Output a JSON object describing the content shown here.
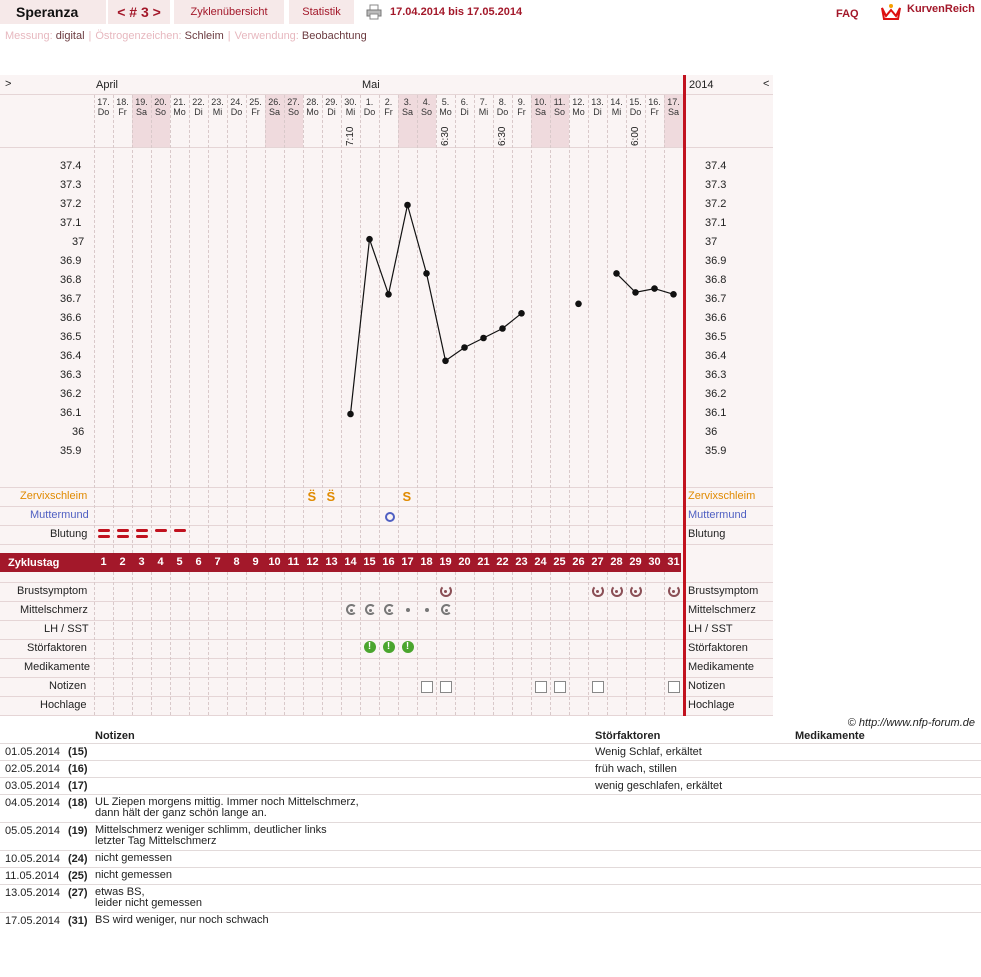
{
  "header": {
    "title": "Speranza",
    "cycle": "< # 3 >",
    "overview": "Zyklenübersicht",
    "statistics": "Statistik",
    "date_range": "17.04.2014 bis 17.05.2014",
    "faq": "FAQ",
    "logo": "KurvenReich"
  },
  "subheader": {
    "measure_label": "Messung:",
    "measure_value": "digital",
    "estrogen_label": "Östrogenzeichen:",
    "estrogen_value": "Schleim",
    "usage_label": "Verwendung:",
    "usage_value": "Beobachtung"
  },
  "nav": {
    "left": ">",
    "right": "<",
    "year": "2014"
  },
  "months": {
    "april": "April",
    "mai": "Mai"
  },
  "days": [
    {
      "d": "17.",
      "w": "Do",
      "we": false
    },
    {
      "d": "18.",
      "w": "Fr",
      "we": false
    },
    {
      "d": "19.",
      "w": "Sa",
      "we": true
    },
    {
      "d": "20.",
      "w": "So",
      "we": true
    },
    {
      "d": "21.",
      "w": "Mo",
      "we": false
    },
    {
      "d": "22.",
      "w": "Di",
      "we": false
    },
    {
      "d": "23.",
      "w": "Mi",
      "we": false
    },
    {
      "d": "24.",
      "w": "Do",
      "we": false
    },
    {
      "d": "25.",
      "w": "Fr",
      "we": false
    },
    {
      "d": "26.",
      "w": "Sa",
      "we": true
    },
    {
      "d": "27.",
      "w": "So",
      "we": true
    },
    {
      "d": "28.",
      "w": "Mo",
      "we": false
    },
    {
      "d": "29.",
      "w": "Di",
      "we": false
    },
    {
      "d": "30.",
      "w": "Mi",
      "we": false
    },
    {
      "d": "1.",
      "w": "Do",
      "we": false
    },
    {
      "d": "2.",
      "w": "Fr",
      "we": false
    },
    {
      "d": "3.",
      "w": "Sa",
      "we": true
    },
    {
      "d": "4.",
      "w": "So",
      "we": true
    },
    {
      "d": "5.",
      "w": "Mo",
      "we": false
    },
    {
      "d": "6.",
      "w": "Di",
      "we": false
    },
    {
      "d": "7.",
      "w": "Mi",
      "we": false
    },
    {
      "d": "8.",
      "w": "Do",
      "we": false
    },
    {
      "d": "9.",
      "w": "Fr",
      "we": false
    },
    {
      "d": "10.",
      "w": "Sa",
      "we": true
    },
    {
      "d": "11.",
      "w": "So",
      "we": true
    },
    {
      "d": "12.",
      "w": "Mo",
      "we": false
    },
    {
      "d": "13.",
      "w": "Di",
      "we": false
    },
    {
      "d": "14.",
      "w": "Mi",
      "we": false
    },
    {
      "d": "15.",
      "w": "Do",
      "we": false
    },
    {
      "d": "16.",
      "w": "Fr",
      "we": false
    },
    {
      "d": "17.",
      "w": "Sa",
      "we": true
    }
  ],
  "times": [
    {
      "day": 14,
      "t": "7:10"
    },
    {
      "day": 19,
      "t": "6:30"
    },
    {
      "day": 22,
      "t": "6:30"
    },
    {
      "day": 29,
      "t": "6:00"
    }
  ],
  "rows_labels": {
    "zervix": "Zervixschleim",
    "muttermund": "Muttermund",
    "blutung": "Blutung",
    "zyklustag": "Zyklustag",
    "brust": "Brustsymptom",
    "mittel": "Mittelschmerz",
    "lh": "LH / SST",
    "stoer": "Störfaktoren",
    "medi": "Medikamente",
    "notizen": "Notizen",
    "hoch": "Hochlage"
  },
  "chart_data": {
    "type": "line",
    "ylim": [
      35.9,
      37.4
    ],
    "yticks": [
      "37.4",
      "37.3",
      "37.2",
      "37.1",
      "37",
      "36.9",
      "36.8",
      "36.7",
      "36.6",
      "36.5",
      "36.4",
      "36.3",
      "36.2",
      "36.1",
      "36",
      "35.9"
    ],
    "x": [
      1,
      2,
      3,
      4,
      5,
      6,
      7,
      8,
      9,
      10,
      11,
      12,
      13,
      14,
      15,
      16,
      17,
      18,
      19,
      20,
      21,
      22,
      23,
      24,
      25,
      26,
      27,
      28,
      29,
      30,
      31
    ],
    "series": [
      {
        "values": [
          null,
          null,
          null,
          null,
          null,
          null,
          null,
          null,
          null,
          null,
          null,
          null,
          null,
          36.1,
          37.02,
          36.73,
          37.2,
          36.84,
          36.38,
          36.45,
          36.5,
          36.55,
          36.63,
          null,
          null,
          36.68,
          null,
          36.84,
          36.74,
          36.76,
          36.73
        ]
      }
    ],
    "connect_segments": [
      [
        14,
        23
      ],
      [
        28,
        31
      ]
    ]
  },
  "markers": {
    "zervix": [
      {
        "day": 12,
        "s": "S̈"
      },
      {
        "day": 13,
        "s": "S̈"
      },
      {
        "day": 17,
        "s": "S"
      }
    ],
    "muttermund": [
      {
        "day": 16,
        "s": "o"
      }
    ],
    "blutung": [
      1,
      2,
      3,
      4,
      5
    ],
    "brust": [
      19,
      27,
      28,
      29,
      31
    ],
    "mittel": [
      14,
      15,
      16,
      17,
      18,
      19
    ],
    "stoer": [
      15,
      16,
      17
    ],
    "notizen": [
      18,
      19,
      24,
      25,
      27,
      31
    ]
  },
  "cycle_days": [
    "1",
    "2",
    "3",
    "4",
    "5",
    "6",
    "7",
    "8",
    "9",
    "10",
    "11",
    "12",
    "13",
    "14",
    "15",
    "16",
    "17",
    "18",
    "19",
    "20",
    "21",
    "22",
    "23",
    "24",
    "25",
    "26",
    "27",
    "28",
    "29",
    "30",
    "31"
  ],
  "copyright": "© http://www.nfp-forum.de",
  "notes_table": {
    "headers": {
      "notes": "Notizen",
      "stoer": "Störfaktoren",
      "medi": "Medikamente"
    },
    "rows": [
      {
        "date": "01.05.2014",
        "cd": "(15)",
        "note": "",
        "stoer": "Wenig Schlaf, erkältet"
      },
      {
        "date": "02.05.2014",
        "cd": "(16)",
        "note": "",
        "stoer": "früh wach, stillen"
      },
      {
        "date": "03.05.2014",
        "cd": "(17)",
        "note": "",
        "stoer": "wenig geschlafen, erkältet"
      },
      {
        "date": "04.05.2014",
        "cd": "(18)",
        "note": "UL Ziepen morgens mittig. Immer noch Mittelschmerz,\ndann hält der ganz schön lange an.",
        "stoer": ""
      },
      {
        "date": "05.05.2014",
        "cd": "(19)",
        "note": "Mittelschmerz weniger schlimm, deutlicher links\nletzter Tag Mittelschmerz",
        "stoer": ""
      },
      {
        "date": "10.05.2014",
        "cd": "(24)",
        "note": "nicht gemessen",
        "stoer": ""
      },
      {
        "date": "11.05.2014",
        "cd": "(25)",
        "note": "nicht gemessen",
        "stoer": ""
      },
      {
        "date": "13.05.2014",
        "cd": "(27)",
        "note": "etwas BS,\nleider nicht gemessen",
        "stoer": ""
      },
      {
        "date": "17.05.2014",
        "cd": "(31)",
        "note": "BS wird weniger, nur noch schwach",
        "stoer": ""
      }
    ]
  }
}
